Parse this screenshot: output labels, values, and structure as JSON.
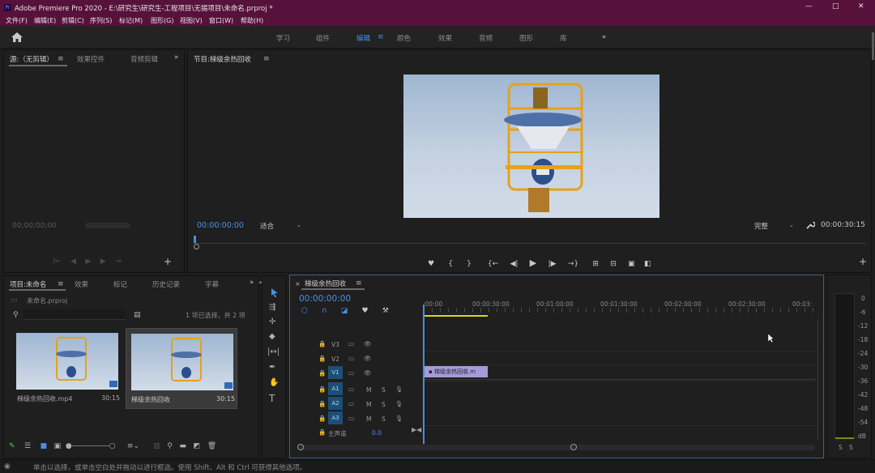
{
  "window": {
    "title": "Adobe Premiere Pro 2020 - E:\\研究生\\研究生-工程项目\\无锡项目\\未命名.prproj *",
    "controls": [
      "—",
      "□",
      "✕"
    ]
  },
  "menu": [
    "文件(F)",
    "编辑(E)",
    "剪辑(C)",
    "序列(S)",
    "标记(M)",
    "图形(G)",
    "视图(V)",
    "窗口(W)",
    "帮助(H)"
  ],
  "workspaces": {
    "items": [
      "学习",
      "组件",
      "编辑",
      "颜色",
      "效果",
      "音频",
      "图形",
      "库"
    ],
    "active": "编辑",
    "more": "»"
  },
  "source_panel": {
    "tabs": [
      "源:（无剪辑）",
      "效果控件",
      "音频剪辑"
    ],
    "active_tab": "源:（无剪辑）",
    "more": "»",
    "timecode": "00;00;00;00"
  },
  "program_panel": {
    "title": "节目:梯级余热回收",
    "timecode": "00:00:00:00",
    "fit": "适合",
    "quality": "完整",
    "duration": "00:00:30:15"
  },
  "project_panel": {
    "tabs": [
      "项目:未命名",
      "效果",
      "标记",
      "历史记录",
      "字幕"
    ],
    "active_tab": "项目:未命名",
    "more": "»",
    "file": "未命名.prproj",
    "selection_info": "1 项已选择，共 2 项",
    "items": [
      {
        "name": "梯级余热回收.mp4",
        "duration": "30:15"
      },
      {
        "name": "梯级余热回收",
        "duration": "30:15"
      }
    ]
  },
  "timeline": {
    "title": "梯级余热回收",
    "timecode": "00:00:00:00",
    "ruler": [
      ":00:00",
      "00:00:30:00",
      "00:01:00:00",
      "00:01:30:00",
      "00:02:00:00",
      "00:02:30:00",
      "00:03:"
    ],
    "video_tracks": [
      "V3",
      "V2",
      "V1"
    ],
    "audio_tracks": [
      "A1",
      "A2",
      "A3"
    ],
    "track_letters": {
      "m": "M",
      "s": "S"
    },
    "master": "主声道",
    "master_value": "0.0",
    "clip_label": "梯级余热回收.m"
  },
  "meter": {
    "labels": [
      "0",
      "-6",
      "-12",
      "-18",
      "-24",
      "-30",
      "-36",
      "-42",
      "-48",
      "-54",
      "dB"
    ],
    "solo": [
      "S",
      "S"
    ]
  },
  "status_bar": "单击以选择，或单击空白处并拖动以进行框选。使用 Shift、Alt 和 Ctrl 可获得其他选项。",
  "colors": {
    "title_bar": "#56123a",
    "accent": "#4a8ee6",
    "clip": "#a69ad6"
  }
}
